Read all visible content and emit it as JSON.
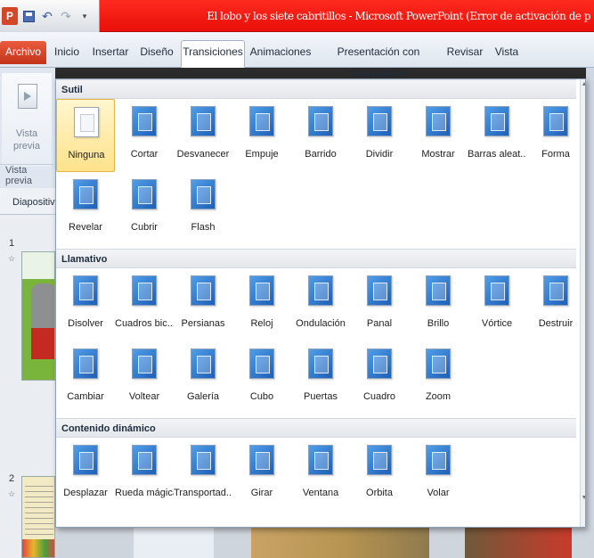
{
  "titlebar": {
    "app_icon": "P",
    "title": "El lobo y los siete cabritillos  -  Microsoft PowerPoint (Error de activación de p"
  },
  "ribbon": {
    "tabs": [
      "Archivo",
      "Inicio",
      "Insertar",
      "Diseño",
      "Transiciones",
      "Animaciones",
      "Presentación con diapositivas",
      "Revisar",
      "Vista"
    ],
    "active_tab": "Transiciones",
    "file_tab_color": "#d8452a"
  },
  "left_panel": {
    "preview_line1": "Vista",
    "preview_line2": "previa",
    "group_label": "Vista previa",
    "slides_tab": "Diapositiva",
    "slide_numbers": [
      "1",
      "2"
    ]
  },
  "gallery": {
    "sections": [
      {
        "title": "Sutil",
        "items": [
          {
            "label": "Ninguna",
            "icon": "none-transition-icon",
            "selected": true
          },
          {
            "label": "Cortar",
            "icon": "cut-transition-icon"
          },
          {
            "label": "Desvanecer",
            "icon": "fade-transition-icon"
          },
          {
            "label": "Empuje",
            "icon": "push-transition-icon"
          },
          {
            "label": "Barrido",
            "icon": "wipe-transition-icon"
          },
          {
            "label": "Dividir",
            "icon": "split-transition-icon"
          },
          {
            "label": "Mostrar",
            "icon": "reveal-transition-icon"
          },
          {
            "label": "Barras aleat...",
            "icon": "random-bars-transition-icon"
          },
          {
            "label": "Forma",
            "icon": "shape-transition-icon"
          },
          {
            "label": "Revelar",
            "icon": "uncover-transition-icon"
          },
          {
            "label": "Cubrir",
            "icon": "cover-transition-icon"
          },
          {
            "label": "Flash",
            "icon": "flash-transition-icon"
          }
        ]
      },
      {
        "title": "Llamativo",
        "items": [
          {
            "label": "Disolver",
            "icon": "dissolve-transition-icon"
          },
          {
            "label": "Cuadros bic...",
            "icon": "checkerboard-transition-icon"
          },
          {
            "label": "Persianas",
            "icon": "blinds-transition-icon"
          },
          {
            "label": "Reloj",
            "icon": "clock-transition-icon"
          },
          {
            "label": "Ondulación",
            "icon": "ripple-transition-icon"
          },
          {
            "label": "Panal",
            "icon": "honeycomb-transition-icon"
          },
          {
            "label": "Brillo",
            "icon": "glitter-transition-icon"
          },
          {
            "label": "Vórtice",
            "icon": "vortex-transition-icon"
          },
          {
            "label": "Destruir",
            "icon": "shred-transition-icon"
          },
          {
            "label": "Cambiar",
            "icon": "switch-transition-icon"
          },
          {
            "label": "Voltear",
            "icon": "flip-transition-icon"
          },
          {
            "label": "Galería",
            "icon": "gallery-transition-icon"
          },
          {
            "label": "Cubo",
            "icon": "cube-transition-icon"
          },
          {
            "label": "Puertas",
            "icon": "doors-transition-icon"
          },
          {
            "label": "Cuadro",
            "icon": "box-transition-icon"
          },
          {
            "label": "Zoom",
            "icon": "zoom-transition-icon"
          }
        ]
      },
      {
        "title": "Contenido dinámico",
        "items": [
          {
            "label": "Desplazar",
            "icon": "pan-transition-icon"
          },
          {
            "label": "Rueda mágica",
            "icon": "ferris-wheel-transition-icon"
          },
          {
            "label": "Transportad...",
            "icon": "conveyor-transition-icon"
          },
          {
            "label": "Girar",
            "icon": "rotate-transition-icon"
          },
          {
            "label": "Ventana",
            "icon": "window-transition-icon"
          },
          {
            "label": "Órbita",
            "icon": "orbit-transition-icon"
          },
          {
            "label": "Volar",
            "icon": "fly-through-transition-icon"
          }
        ]
      }
    ]
  }
}
